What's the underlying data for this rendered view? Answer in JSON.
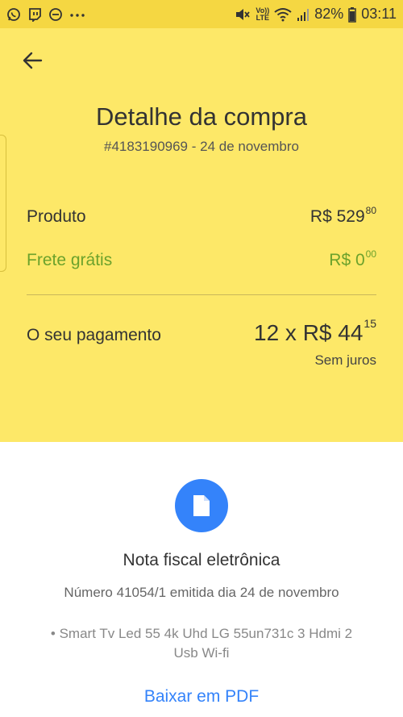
{
  "status_bar": {
    "battery": "82%",
    "time": "03:11",
    "volte_top": "Vo))",
    "volte_bottom": "LTE",
    "left_icons": [
      "whatsapp-icon",
      "twitch-icon",
      "do-not-disturb-icon",
      "more-dots-icon"
    ],
    "right_icons": [
      "mute-icon",
      "volte-icon",
      "wifi-icon",
      "signal-icon"
    ]
  },
  "colors": {
    "header_bg": "#fde868",
    "status_bg": "#f5d742",
    "green": "#6ca22c",
    "accent_blue": "#3483fa"
  },
  "header": {
    "title": "Detalhe da compra",
    "subtitle": "#4183190969 - 24 de novembro"
  },
  "summary": {
    "product_label": "Produto",
    "product_value_main": "R$ 529",
    "product_value_cents": "80",
    "shipping_label": "Frete grátis",
    "shipping_value_main": "R$ 0",
    "shipping_value_cents": "00",
    "payment_label": "O seu pagamento",
    "payment_value_main": "12 x R$ 44",
    "payment_value_cents": "15",
    "payment_note": "Sem juros"
  },
  "invoice": {
    "icon": "document-icon",
    "title": "Nota fiscal eletrônica",
    "number_text": "Número 41054/1 emitida dia 24 de novembro",
    "item_text": "• Smart Tv Led 55 4k Uhd LG 55un731c 3 Hdmi 2 Usb Wi-fi",
    "download_link": "Baixar em PDF"
  }
}
